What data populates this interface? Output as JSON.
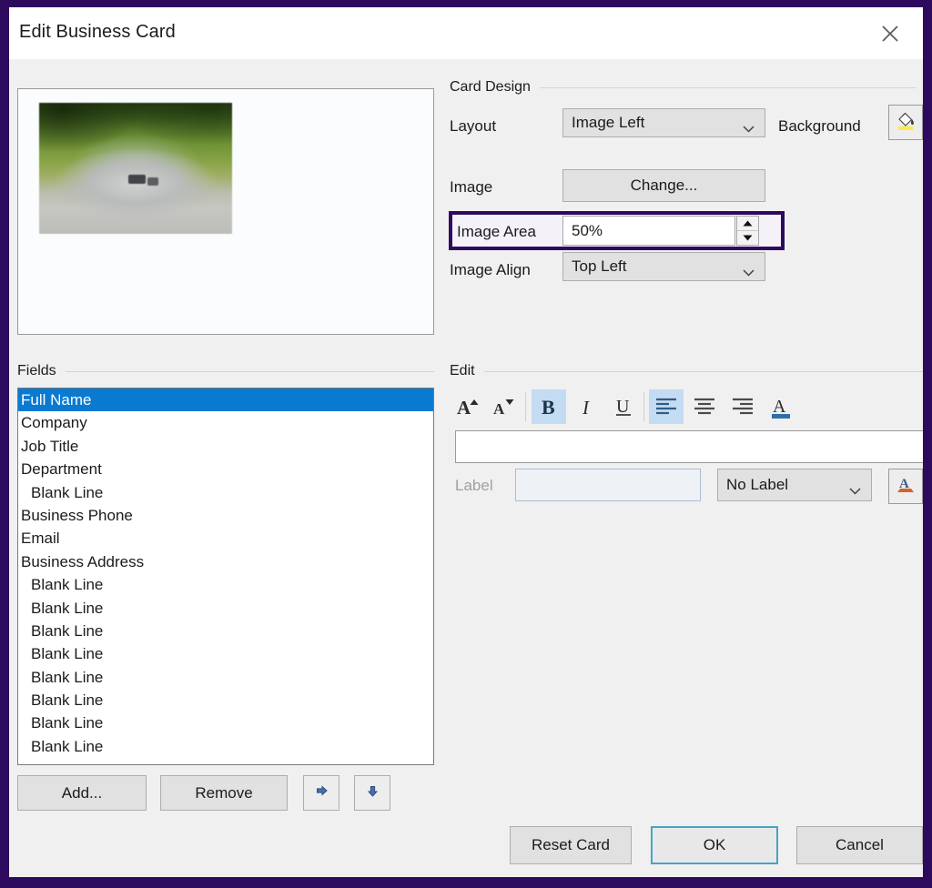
{
  "window": {
    "title": "Edit Business Card",
    "close_icon": "close-icon"
  },
  "preview": {
    "image_alt": "tree-lined road photo"
  },
  "card_design": {
    "section_title": "Card Design",
    "layout_label": "Layout",
    "layout_value": "Image Left",
    "background_label": "Background",
    "background_icon": "paint-bucket-icon",
    "image_label": "Image",
    "change_button": "Change...",
    "image_area_label": "Image Area",
    "image_area_value": "50%",
    "spinner_up_icon": "spinner-up-icon",
    "spinner_down_icon": "spinner-down-icon",
    "image_align_label": "Image Align",
    "image_align_value": "Top Left",
    "highlight_color": "#2d0a5e"
  },
  "fields": {
    "section_title": "Fields",
    "items": [
      {
        "label": "Full Name",
        "indent": false,
        "selected": true
      },
      {
        "label": "Company",
        "indent": false,
        "selected": false
      },
      {
        "label": "Job Title",
        "indent": false,
        "selected": false
      },
      {
        "label": "Department",
        "indent": false,
        "selected": false
      },
      {
        "label": "Blank Line",
        "indent": true,
        "selected": false
      },
      {
        "label": "Business Phone",
        "indent": false,
        "selected": false
      },
      {
        "label": "Email",
        "indent": false,
        "selected": false
      },
      {
        "label": "Business Address",
        "indent": false,
        "selected": false
      },
      {
        "label": "Blank Line",
        "indent": true,
        "selected": false
      },
      {
        "label": "Blank Line",
        "indent": true,
        "selected": false
      },
      {
        "label": "Blank Line",
        "indent": true,
        "selected": false
      },
      {
        "label": "Blank Line",
        "indent": true,
        "selected": false
      },
      {
        "label": "Blank Line",
        "indent": true,
        "selected": false
      },
      {
        "label": "Blank Line",
        "indent": true,
        "selected": false
      },
      {
        "label": "Blank Line",
        "indent": true,
        "selected": false
      },
      {
        "label": "Blank Line",
        "indent": true,
        "selected": false
      }
    ],
    "selection_color": "#0a7ad1",
    "add_button": "Add...",
    "remove_button": "Remove",
    "move_up_icon": "arrow-up-icon",
    "move_down_icon": "arrow-down-icon"
  },
  "edit": {
    "section_title": "Edit",
    "toolbar": [
      {
        "name": "grow-font-icon",
        "glyph": "A",
        "active": false
      },
      {
        "name": "shrink-font-icon",
        "glyph": "A",
        "active": false
      },
      {
        "name": "bold-icon",
        "glyph": "B",
        "active": true
      },
      {
        "name": "italic-icon",
        "glyph": "I",
        "active": false
      },
      {
        "name": "underline-icon",
        "glyph": "U",
        "active": false
      },
      {
        "name": "align-left-icon",
        "glyph": "",
        "active": true
      },
      {
        "name": "align-center-icon",
        "glyph": "",
        "active": false
      },
      {
        "name": "align-right-icon",
        "glyph": "",
        "active": false
      },
      {
        "name": "font-color-icon",
        "glyph": "A",
        "active": false
      }
    ],
    "text_value": "",
    "label_label": "Label",
    "label_value": "",
    "label_type_value": "No Label",
    "label_color_icon": "label-font-color-icon"
  },
  "footer": {
    "reset_button": "Reset Card",
    "ok_button": "OK",
    "cancel_button": "Cancel",
    "focus_color": "#4aa3c4"
  }
}
